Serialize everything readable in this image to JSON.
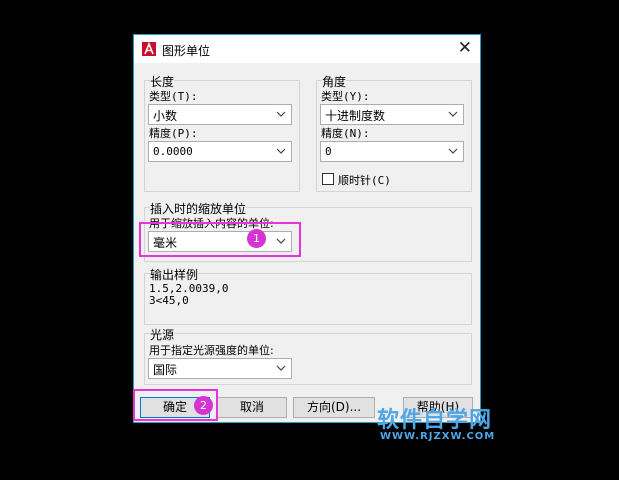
{
  "title": "图形单位",
  "length": {
    "group_label": "长度",
    "type_label": "类型(T):",
    "type_value": "小数",
    "precision_label": "精度(P):",
    "precision_value": "0.0000"
  },
  "angle": {
    "group_label": "角度",
    "type_label": "类型(Y):",
    "type_value": "十进制度数",
    "precision_label": "精度(N):",
    "precision_value": "0",
    "clockwise_label": "顺时针(C)",
    "clockwise_checked": false
  },
  "insertion": {
    "group_label": "插入时的缩放单位",
    "field_label": "用于缩放插入内容的单位:",
    "value": "毫米"
  },
  "sample": {
    "group_label": "输出样例",
    "line1": "1.5,2.0039,0",
    "line2": "3<45,0"
  },
  "lighting": {
    "group_label": "光源",
    "field_label": "用于指定光源强度的单位:",
    "value": "国际"
  },
  "buttons": {
    "ok": "确定",
    "cancel": "取消",
    "direction": "方向(D)...",
    "help": "帮助(H)"
  },
  "annotations": {
    "badge1": "1",
    "badge2": "2",
    "highlight_color": "#e535d9"
  },
  "watermark": {
    "main": "软件自学网",
    "url": "WWW.RJZXW.COM"
  },
  "colors": {
    "accent": "#0078d7",
    "app_icon": "#c8102e",
    "watermark": "#4ea6e6"
  }
}
